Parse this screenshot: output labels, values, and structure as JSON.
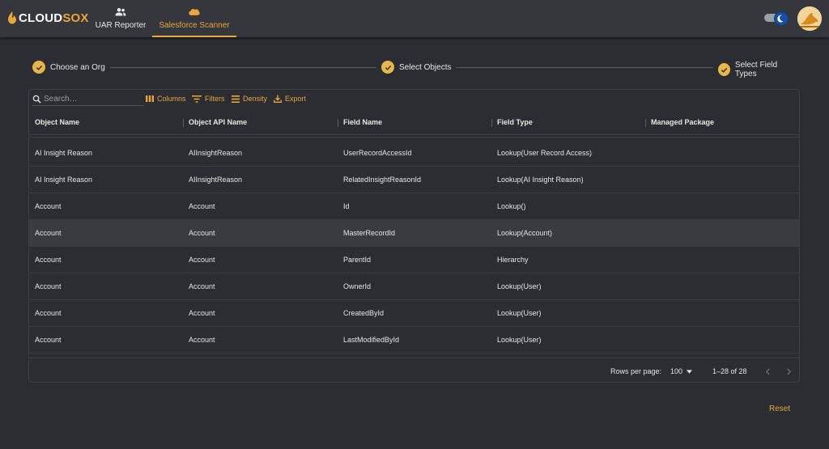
{
  "app": {
    "logo_part1": "CLOUD",
    "logo_part2": "SOX",
    "brand_color": "#e8a63b"
  },
  "nav": {
    "tabs": [
      {
        "label": "UAR Reporter",
        "icon": "people-icon",
        "active": false
      },
      {
        "label": "Salesforce Scanner",
        "icon": "salesforce-cloud-icon",
        "active": true
      }
    ]
  },
  "stepper": {
    "steps": [
      {
        "label": "Choose an Org",
        "done": true
      },
      {
        "label": "Select Objects",
        "done": true
      },
      {
        "label": "Select Field Types",
        "done": true
      }
    ]
  },
  "toolbar": {
    "search_placeholder": "Search…",
    "columns_label": "Columns",
    "filters_label": "Filters",
    "density_label": "Density",
    "export_label": "Export"
  },
  "table": {
    "columns": [
      "Object Name",
      "Object API Name",
      "Field Name",
      "Field Type",
      "Managed Package"
    ],
    "rows": [
      [
        "AI Insight Reason",
        "AIInsightReason",
        "UserRecordAccessId",
        "Lookup(User Record Access)",
        ""
      ],
      [
        "AI Insight Reason",
        "AIInsightReason",
        "RelatedInsightReasonId",
        "Lookup(AI Insight Reason)",
        ""
      ],
      [
        "Account",
        "Account",
        "Id",
        "Lookup()",
        ""
      ],
      [
        "Account",
        "Account",
        "MasterRecordId",
        "Lookup(Account)",
        ""
      ],
      [
        "Account",
        "Account",
        "ParentId",
        "Hierarchy",
        ""
      ],
      [
        "Account",
        "Account",
        "OwnerId",
        "Lookup(User)",
        ""
      ],
      [
        "Account",
        "Account",
        "CreatedById",
        "Lookup(User)",
        ""
      ],
      [
        "Account",
        "Account",
        "LastModifiedById",
        "Lookup(User)",
        ""
      ]
    ],
    "highlighted_row": 3
  },
  "pagination": {
    "rows_per_page_label": "Rows per page:",
    "rows_per_page_value": "100",
    "range_text": "1–28 of 28"
  },
  "actions": {
    "reset_label": "Reset"
  }
}
